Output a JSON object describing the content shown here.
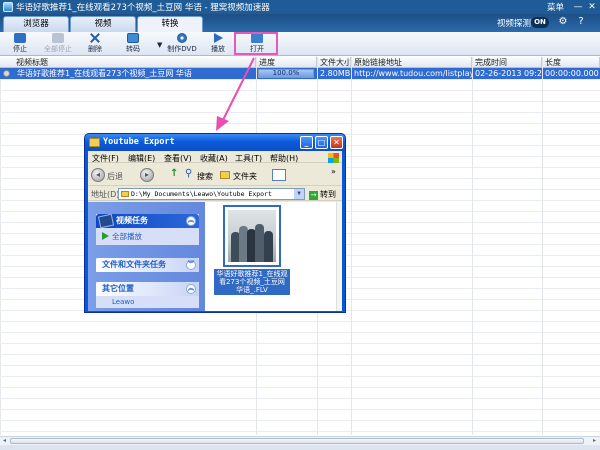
{
  "app": {
    "title": "华语好歌推荐1_在线观看273个视频_土豆网 华语 - 狸窝视频加速器",
    "menu_label": "菜单",
    "minimize": "—",
    "close": "✕"
  },
  "tabs": [
    {
      "label": "浏览器",
      "active": false
    },
    {
      "label": "视频",
      "active": false
    },
    {
      "label": "转换",
      "active": true
    }
  ],
  "top_right": {
    "slow_label": "视频探测",
    "toggle": "ON",
    "gear_icon": "gear-icon",
    "help_icon": "help-icon"
  },
  "toolbar": {
    "stop": "停止",
    "stop_all": "全部停止",
    "delete": "删除",
    "convert": "转码",
    "make_dvd": "制作DVD",
    "play": "播放",
    "open": "打开",
    "dropdown": "▼"
  },
  "table": {
    "headers": [
      "视频标题",
      "进度",
      "文件大小",
      "原始链接地址",
      "完成时间",
      "长度"
    ],
    "rows": [
      {
        "title": "华语好歌推荐1_在线观看273个视频_土豆网 华语",
        "progress": 100.0,
        "progress_text": "100.0%",
        "size": "2.80MB",
        "url": "http://www.tudou.com/listplay...",
        "completed": "02-26-2013 09:2...",
        "length": "00:00:00.000"
      }
    ]
  },
  "scroll": {
    "left": "◂",
    "right": "▸"
  },
  "explorer": {
    "title": "Youtube Export",
    "buttons": {
      "min": "_",
      "max": "□",
      "close": "✕"
    },
    "menu": [
      "文件(F)",
      "编辑(E)",
      "查看(V)",
      "收藏(A)",
      "工具(T)",
      "帮助(H)"
    ],
    "toolbar": {
      "back": "后退",
      "back_arrow": "◂",
      "forward_arrow": "▸",
      "up_arrow": "↑",
      "search": "搜索",
      "folders": "文件夹",
      "more": "»"
    },
    "address_label": "地址(D)",
    "address_value": "D:\\My Documents\\Leawo\\Youtube Export",
    "goto_label": "转到",
    "goto_arrow": "→",
    "dropdown": "▼",
    "panels": {
      "video_tasks": "视频任务",
      "play_all": "全部播放",
      "file_tasks": "文件和文件夹任务",
      "other_places": "其它位置",
      "other_item": "Leawo"
    },
    "chevrons": {
      "up": "︽",
      "down": "︾"
    },
    "file": {
      "caption": "华语好歌推荐1_在线观看273个视频_土豆网 华语_.FLV"
    }
  },
  "colors": {
    "titlebar": "#1f5c97",
    "selection": "#2f6bd1",
    "highlight_box": "#e35bb8",
    "arrow": "#e94fb0"
  }
}
